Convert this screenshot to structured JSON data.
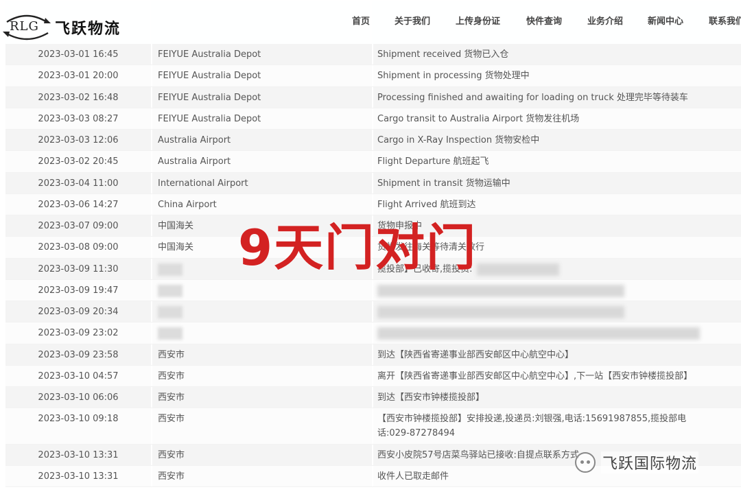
{
  "header": {
    "logo_text": "RLG",
    "brand_name": "飞跃物流",
    "nav": [
      "首页",
      "关于我们",
      "上传身份证",
      "快件查询",
      "业务介绍",
      "新闻中心",
      "联系我们"
    ]
  },
  "table": {
    "rows": [
      {
        "time": "2023-03-01 16:45",
        "location": "FEIYUE Australia Depot",
        "status": "Shipment received 货物已入仓"
      },
      {
        "time": "2023-03-01 20:00",
        "location": "FEIYUE Australia Depot",
        "status": "Shipment in processing 货物处理中"
      },
      {
        "time": "2023-03-02 16:48",
        "location": "FEIYUE Australia Depot",
        "status": "Processing finished and awaiting for loading on truck 处理完毕等待装车"
      },
      {
        "time": "2023-03-03 08:27",
        "location": "FEIYUE Australia Depot",
        "status": "Cargo transit to Australia Airport 货物发往机场"
      },
      {
        "time": "2023-03-03 12:06",
        "location": "Australia Airport",
        "status": "Cargo in X-Ray Inspection 货物安检中"
      },
      {
        "time": "2023-03-02 20:45",
        "location": "Australia Airport",
        "status": "Flight Departure 航班起飞"
      },
      {
        "time": "2023-03-04 11:00",
        "location": "International Airport",
        "status": "Shipment in transit 货物运输中"
      },
      {
        "time": "2023-03-06 14:27",
        "location": "China Airport",
        "status": "Flight Arrived 航班到达"
      },
      {
        "time": "2023-03-07 09:00",
        "location": "中国海关",
        "status": "货物申报中"
      },
      {
        "time": "2023-03-08 09:00",
        "location": "中国海关",
        "status": "货物发往海关等待清关放行"
      },
      {
        "time": "2023-03-09 11:30",
        "location": "",
        "status": "揽投部】已收寄,揽投员:"
      },
      {
        "time": "2023-03-09 19:47",
        "location": "",
        "status": ""
      },
      {
        "time": "2023-03-09 20:34",
        "location": "",
        "status": ""
      },
      {
        "time": "2023-03-09 23:02",
        "location": "",
        "status": ""
      },
      {
        "time": "2023-03-09 23:58",
        "location": "西安市",
        "status": "到达【陕西省寄递事业部西安邮区中心航空中心】"
      },
      {
        "time": "2023-03-10 04:57",
        "location": "西安市",
        "status": "离开【陕西省寄递事业部西安邮区中心航空中心】,下一站【西安市钟楼揽投部】"
      },
      {
        "time": "2023-03-10 06:06",
        "location": "西安市",
        "status": "到达【西安市钟楼揽投部】"
      },
      {
        "time": "2023-03-10 09:18",
        "location": "西安市",
        "status": "【西安市钟楼揽投部】安排投递,投递员:刘银强,电话:15691987855,揽投部电话:029-87278494"
      },
      {
        "time": "2023-03-10 13:31",
        "location": "西安市",
        "status": "西安小皮院57号店菜鸟驿站已接收:自提点联系方式"
      },
      {
        "time": "2023-03-10 13:31",
        "location": "西安市",
        "status": "收件人已取走邮件"
      }
    ]
  },
  "overlay": {
    "caption": "9天门对门"
  },
  "watermark": {
    "text": "飞跃国际物流"
  }
}
